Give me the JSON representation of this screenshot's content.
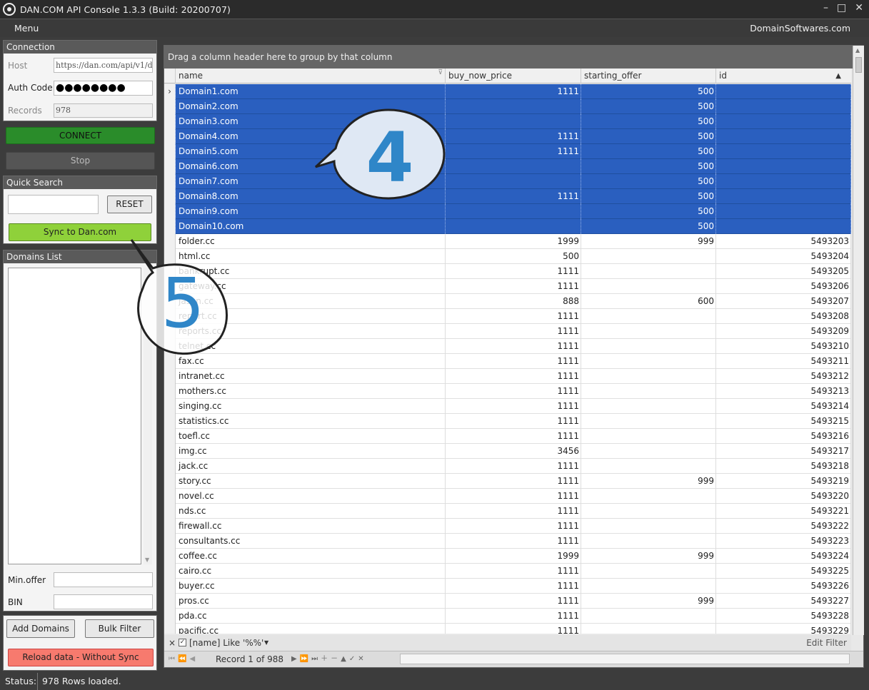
{
  "window": {
    "title": "DAN.COM API Console 1.3.3  (Build: 20200707)",
    "minimize": "–",
    "maximize": "□",
    "close": "✕"
  },
  "menubar": {
    "menu": "Menu",
    "site": "DomainSoftwares.com"
  },
  "connection": {
    "header": "Connection",
    "host_label": "Host",
    "host_value": "https://dan.com/api/v1/domai",
    "auth_label": "Auth Code",
    "auth_value": "●●●●●●●●",
    "records_label": "Records",
    "records_value": "978",
    "connect": "CONNECT",
    "stop": "Stop"
  },
  "quicksearch": {
    "header": "Quick Search",
    "value": "",
    "reset": "RESET",
    "sync": "Sync to Dan.com"
  },
  "domains_list": {
    "header": "Domains List",
    "minoffer_label": "Min.offer",
    "bin_label": "BIN",
    "add": "Add Domains",
    "bulk": "Bulk Filter",
    "reload": "Reload data - Without Sync"
  },
  "grid": {
    "group_hint": "Drag a column header here to group by that column",
    "columns": [
      "name",
      "buy_now_price",
      "starting_offer",
      "id"
    ],
    "rows": [
      [
        "Domain1.com",
        "1111",
        "500",
        ""
      ],
      [
        "Domain2.com",
        "",
        "500",
        ""
      ],
      [
        "Domain3.com",
        "",
        "500",
        ""
      ],
      [
        "Domain4.com",
        "1111",
        "500",
        ""
      ],
      [
        "Domain5.com",
        "1111",
        "500",
        ""
      ],
      [
        "Domain6.com",
        "",
        "500",
        ""
      ],
      [
        "Domain7.com",
        "",
        "500",
        ""
      ],
      [
        "Domain8.com",
        "1111",
        "500",
        ""
      ],
      [
        "Domain9.com",
        "",
        "500",
        ""
      ],
      [
        "Domain10.com",
        "",
        "500",
        ""
      ],
      [
        "folder.cc",
        "1999",
        "999",
        "5493203"
      ],
      [
        "html.cc",
        "500",
        "",
        "5493204"
      ],
      [
        "bankrupt.cc",
        "1111",
        "",
        "5493205"
      ],
      [
        "gateway.cc",
        "1111",
        "",
        "5493206"
      ],
      [
        "jason.cc",
        "888",
        "600",
        "5493207"
      ],
      [
        "report.cc",
        "1111",
        "",
        "5493208"
      ],
      [
        "reports.cc",
        "1111",
        "",
        "5493209"
      ],
      [
        "telnet.cc",
        "1111",
        "",
        "5493210"
      ],
      [
        "fax.cc",
        "1111",
        "",
        "5493211"
      ],
      [
        "intranet.cc",
        "1111",
        "",
        "5493212"
      ],
      [
        "mothers.cc",
        "1111",
        "",
        "5493213"
      ],
      [
        "singing.cc",
        "1111",
        "",
        "5493214"
      ],
      [
        "statistics.cc",
        "1111",
        "",
        "5493215"
      ],
      [
        "toefl.cc",
        "1111",
        "",
        "5493216"
      ],
      [
        "img.cc",
        "3456",
        "",
        "5493217"
      ],
      [
        "jack.cc",
        "1111",
        "",
        "5493218"
      ],
      [
        "story.cc",
        "1111",
        "999",
        "5493219"
      ],
      [
        "novel.cc",
        "1111",
        "",
        "5493220"
      ],
      [
        "nds.cc",
        "1111",
        "",
        "5493221"
      ],
      [
        "firewall.cc",
        "1111",
        "",
        "5493222"
      ],
      [
        "consultants.cc",
        "1111",
        "",
        "5493223"
      ],
      [
        "coffee.cc",
        "1999",
        "999",
        "5493224"
      ],
      [
        "cairo.cc",
        "1111",
        "",
        "5493225"
      ],
      [
        "buyer.cc",
        "1111",
        "",
        "5493226"
      ],
      [
        "pros.cc",
        "1111",
        "999",
        "5493227"
      ],
      [
        "pda.cc",
        "1111",
        "",
        "5493228"
      ],
      [
        "pacific.cc",
        "1111",
        "",
        "5493229"
      ]
    ],
    "selected_count": 10,
    "filter_text": "[name] Like '%%'",
    "edit_filter": "Edit Filter",
    "record_text": "Record 1 of 988"
  },
  "callouts": {
    "four": "4",
    "five": "5",
    "color": "#2f86c8"
  },
  "status": {
    "label": "Status:",
    "text": "978 Rows loaded."
  }
}
